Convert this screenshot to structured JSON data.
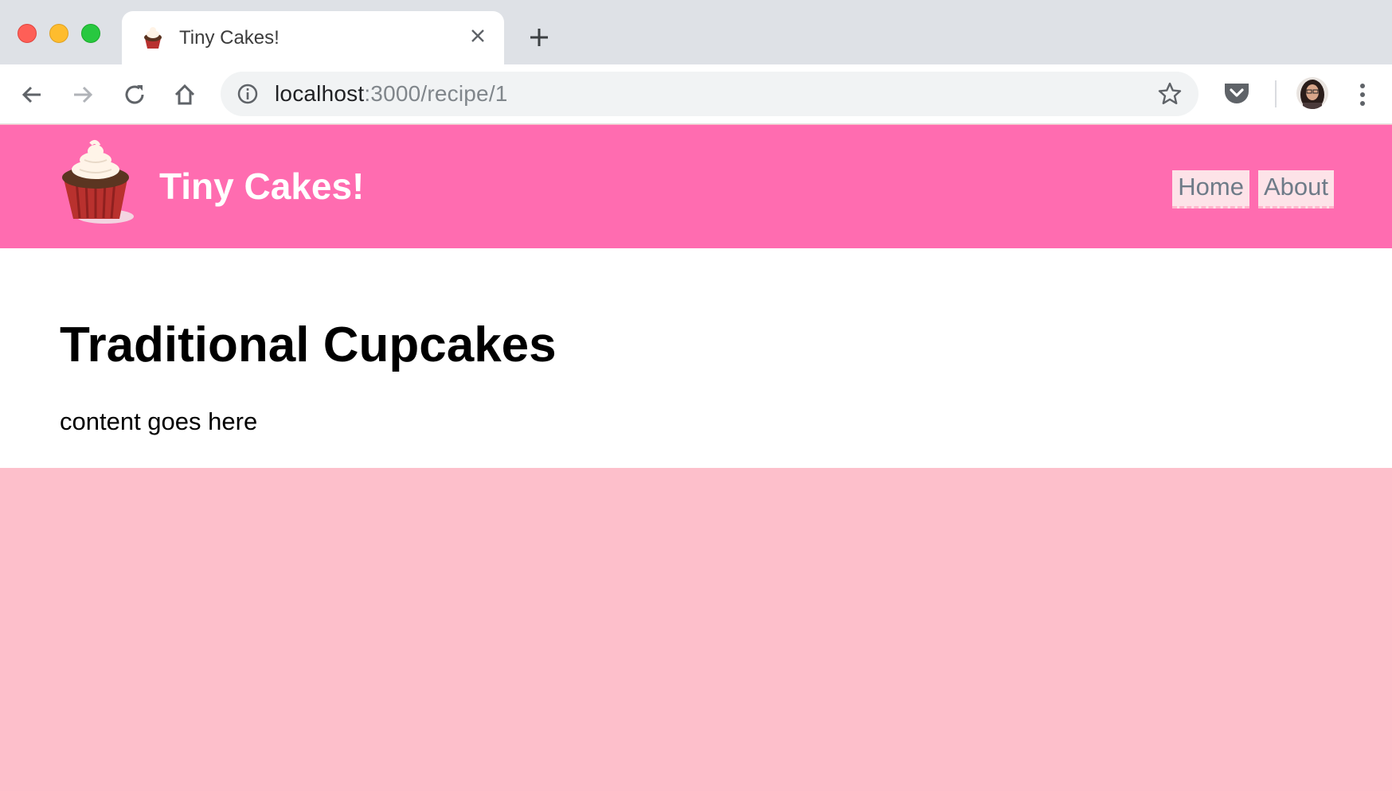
{
  "browser": {
    "tab": {
      "title": "Tiny Cakes!",
      "favicon": "cupcake-icon"
    },
    "address_bar": {
      "host": "localhost",
      "rest": ":3000/recipe/1"
    },
    "icons": [
      "back-arrow-icon",
      "forward-arrow-icon",
      "reload-icon",
      "home-icon",
      "info-icon",
      "star-icon",
      "pocket-icon",
      "profile-avatar",
      "more-menu-icon",
      "close-icon",
      "plus-icon"
    ]
  },
  "site": {
    "brand": "Tiny Cakes!",
    "logo": "cupcake-logo",
    "nav": [
      {
        "label": "Home"
      },
      {
        "label": "About"
      }
    ]
  },
  "page": {
    "title": "Traditional Cupcakes",
    "body": "content goes here"
  },
  "colors": {
    "header": "#ff6cb0",
    "page_background": "#fdbfcb",
    "nav_button_bg": "#fde3e8",
    "nav_text": "#6e7b88"
  }
}
